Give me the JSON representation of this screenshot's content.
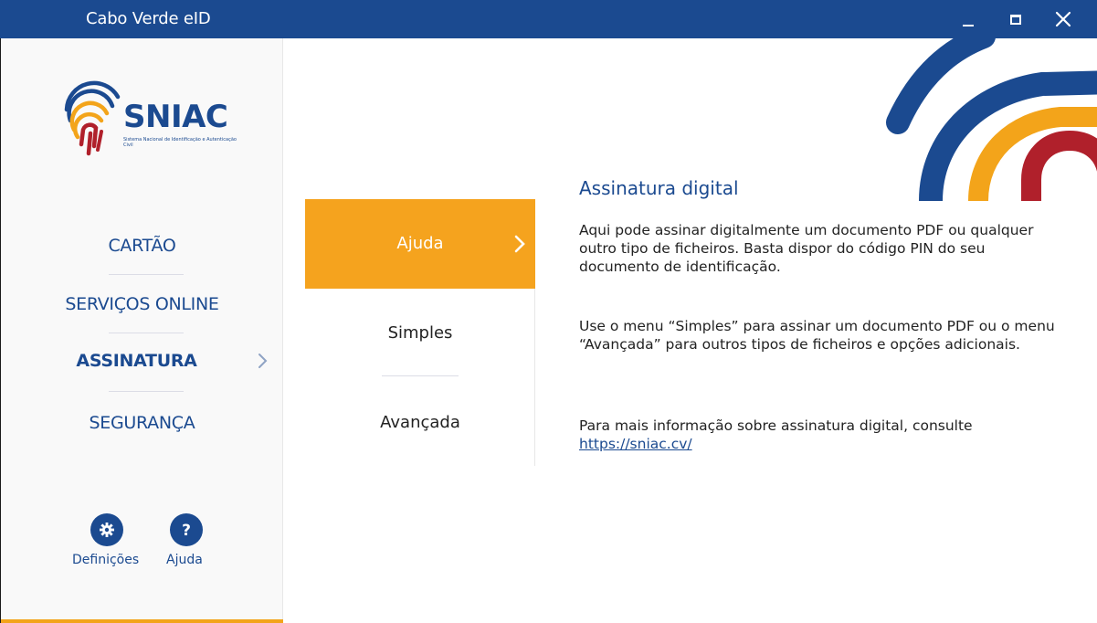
{
  "window": {
    "title": "Cabo Verde eID",
    "controls": [
      "minimize",
      "maximize",
      "close"
    ]
  },
  "logo": {
    "brand": "SNIAC",
    "subtitle": "Sistema Nacional de Identificação e Autenticação Civil"
  },
  "sidebar": {
    "items": [
      {
        "label": "CARTÃO",
        "active": false
      },
      {
        "label": "SERVIÇOS ONLINE",
        "active": false
      },
      {
        "label": "ASSINATURA",
        "active": true
      },
      {
        "label": "SEGURANÇA",
        "active": false
      }
    ],
    "settings_label": "Definições",
    "help_label": "Ajuda",
    "settings_icon": "gear-icon",
    "help_icon": "question-icon"
  },
  "submenu": {
    "items": [
      {
        "label": "Ajuda",
        "active": true
      },
      {
        "label": "Simples",
        "active": false
      },
      {
        "label": "Avançada",
        "active": false
      }
    ]
  },
  "content": {
    "heading": "Assinatura digital",
    "paragraph1": "Aqui pode assinar digitalmente um documento PDF ou qualquer outro tipo de ficheiros. Basta dispor do código PIN do seu documento de identificação.",
    "paragraph2": "Use o menu “Simples” para assinar um documento PDF ou o menu “Avançada” para outros tipos de ficheiros e opções adicionais.",
    "paragraph3_text": "Para mais informação sobre assinatura digital, consulte",
    "paragraph3_link": " https://sniac.cv/"
  },
  "colors": {
    "primary": "#1b4a90",
    "accent": "#f5a31e",
    "red": "#b0202b"
  }
}
